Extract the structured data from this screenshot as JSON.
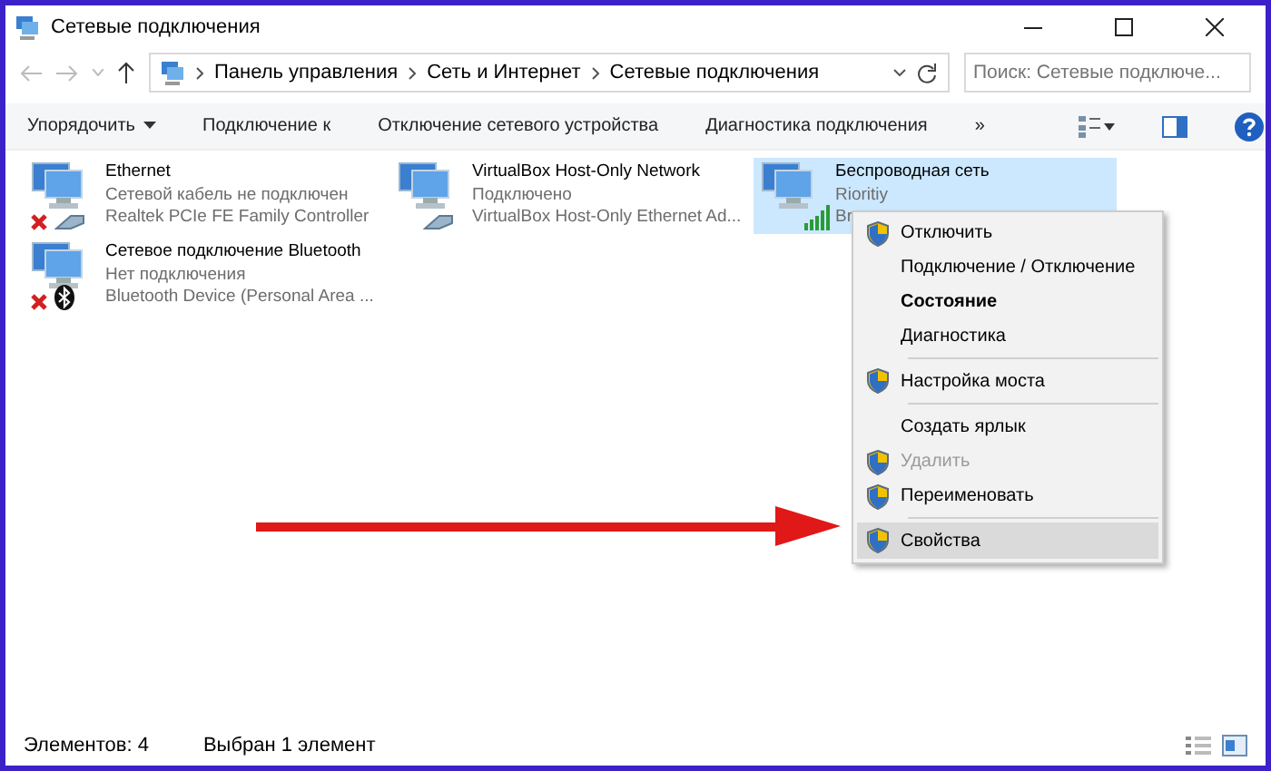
{
  "window": {
    "title": "Сетевые подключения"
  },
  "address_bar": {
    "breadcrumbs": [
      "Панель управления",
      "Сеть и Интернет",
      "Сетевые подключения"
    ],
    "search_placeholder": "Поиск: Сетевые подключе..."
  },
  "toolbar": [
    {
      "label": "Упорядочить",
      "kind": "dropdown"
    },
    {
      "label": "Подключение к",
      "kind": "plain"
    },
    {
      "label": "Отключение сетевого устройства",
      "kind": "plain"
    },
    {
      "label": "Диагностика подключения",
      "kind": "plain"
    },
    {
      "label": "»",
      "kind": "plain"
    }
  ],
  "adapters": [
    {
      "name": "Ethernet",
      "status": "Сетевой кабель не подключен",
      "device": "Realtek PCIe FE Family Controller",
      "kind": "disconnected",
      "selected": false
    },
    {
      "name": "VirtualBox Host-Only Network",
      "status": "Подключено",
      "device": "VirtualBox Host-Only Ethernet Ad...",
      "kind": "wired",
      "selected": false
    },
    {
      "name": "Беспроводная сеть",
      "status": "Rioritiy",
      "device": "Br",
      "kind": "wireless",
      "selected": true
    },
    {
      "name": "Сетевое подключение Bluetooth",
      "status": "Нет подключения",
      "device": "Bluetooth Device (Personal Area ...",
      "kind": "bluetooth",
      "selected": false
    }
  ],
  "context_menu": [
    {
      "label": "Отключить",
      "shield": true,
      "bold": false,
      "disabled": false,
      "selected": false,
      "separator_before": false
    },
    {
      "label": "Подключение / Отключение",
      "shield": false,
      "bold": false,
      "disabled": false,
      "selected": false,
      "separator_before": false
    },
    {
      "label": "Состояние",
      "shield": false,
      "bold": true,
      "disabled": false,
      "selected": false,
      "separator_before": false
    },
    {
      "label": "Диагностика",
      "shield": false,
      "bold": false,
      "disabled": false,
      "selected": false,
      "separator_before": false
    },
    {
      "label": "Настройка моста",
      "shield": true,
      "bold": false,
      "disabled": false,
      "selected": false,
      "separator_before": true
    },
    {
      "label": "Создать ярлык",
      "shield": false,
      "bold": false,
      "disabled": false,
      "selected": false,
      "separator_before": true
    },
    {
      "label": "Удалить",
      "shield": true,
      "bold": false,
      "disabled": true,
      "selected": false,
      "separator_before": false
    },
    {
      "label": "Переименовать",
      "shield": true,
      "bold": false,
      "disabled": false,
      "selected": false,
      "separator_before": false
    },
    {
      "label": "Свойства",
      "shield": true,
      "bold": false,
      "disabled": false,
      "selected": true,
      "separator_before": true
    }
  ],
  "status_bar": {
    "items": "Элементов: 4",
    "selection": "Выбран 1 элемент"
  }
}
